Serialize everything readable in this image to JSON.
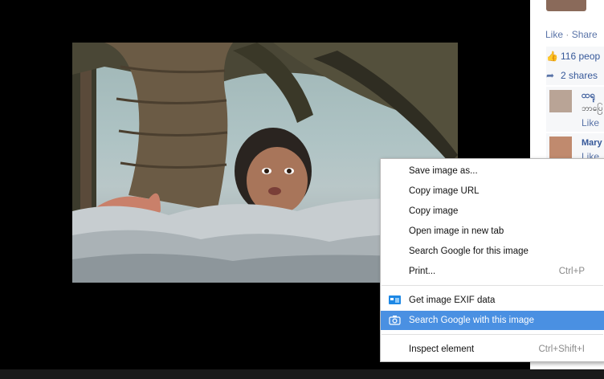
{
  "side_panel": {
    "like_label": "Like",
    "separator": "·",
    "share_label": "Share",
    "likes_text": "116 peop",
    "shares_text": "2 shares",
    "comments": [
      {
        "name": "ထရု",
        "text": "ဘာပြေ",
        "action": "Like"
      },
      {
        "name": "Mary",
        "text": "",
        "action": "Like"
      }
    ]
  },
  "context_menu": {
    "items": [
      {
        "label": "Save image as...",
        "shortcut": ""
      },
      {
        "label": "Copy image URL",
        "shortcut": ""
      },
      {
        "label": "Copy image",
        "shortcut": ""
      },
      {
        "label": "Open image in new tab",
        "shortcut": ""
      },
      {
        "label": "Search Google for this image",
        "shortcut": ""
      },
      {
        "label": "Print...",
        "shortcut": "Ctrl+P"
      },
      {
        "label": "Get image EXIF data",
        "shortcut": "",
        "icon": "exif-icon",
        "icon_color": "#1e88e5"
      },
      {
        "label": "Search Google with this image",
        "shortcut": "",
        "icon": "camera-icon",
        "highlighted": true
      },
      {
        "label": "Inspect element",
        "shortcut": "Ctrl+Shift+I"
      }
    ]
  },
  "colors": {
    "highlight": "#4a90e2",
    "fb_link": "#5a74a8",
    "fb_name": "#365899"
  }
}
